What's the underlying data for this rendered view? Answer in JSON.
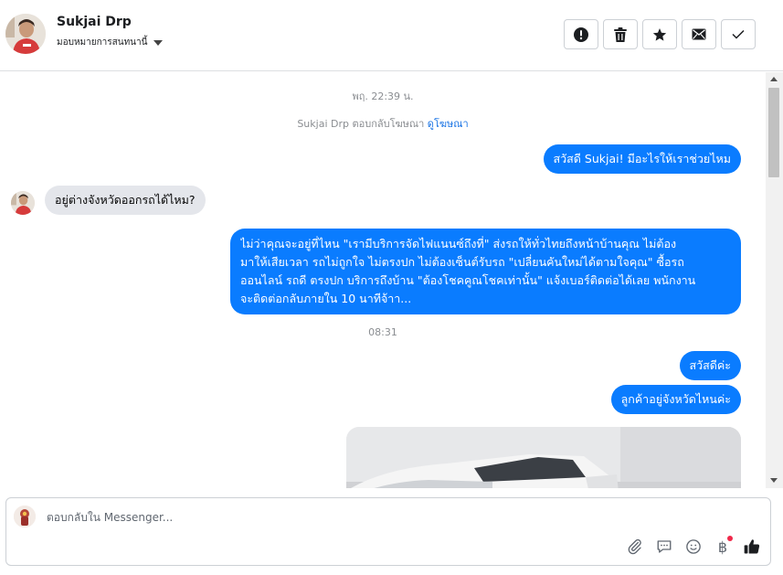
{
  "header": {
    "contact_name": "Sukjai Drp",
    "assign_label": "มอบหมายการสนทนานี้",
    "actions": [
      {
        "name": "report",
        "icon": "exclamation-circle-icon"
      },
      {
        "name": "delete",
        "icon": "trash-icon"
      },
      {
        "name": "star",
        "icon": "star-icon"
      },
      {
        "name": "mark-unread",
        "icon": "envelope-icon"
      },
      {
        "name": "mark-done",
        "icon": "check-icon"
      }
    ]
  },
  "chat": {
    "timestamp_1": "พฤ. 22:39 น.",
    "ad_notice": "Sukjai Drp ตอบกลับโฆษณา",
    "ad_link": "ดูโฆษณา",
    "msg_out_1": "สวัสดี Sukjai! มีอะไรให้เราช่วยไหม",
    "msg_in_1": "อยู่ต่างจังหวัดออกรถได้ไหม?",
    "msg_out_2_line1": "ไม่ว่าคุณจะอยู่ที่ไหน \"เรามีบริการจัดไฟแนนซ์ถึงที่\"  ส่งรถให้ทั่วไทยถึงหน้าบ้านคุณ ไม่ต้อง",
    "msg_out_2_line2": "มาให้เสียเวลา รถไม่ถูกใจ ไม่ตรงปก ไม่ต้องเซ็นต์รับรถ \"เปลี่ยนคันใหม่ได้ตามใจคุณ\" ซื้อรถ",
    "msg_out_2_line3": "ออนไลน์ รถดี ตรงปก บริการถึงบ้าน \"ต้องโชคคูณโชคเท่านั้น\" แจ้งเบอร์ติดต่อได้เลย พนักงาน",
    "msg_out_2_line4": "จะติดต่อกลับภายใน 10 นาทีจ้าา...",
    "timestamp_2": "08:31",
    "msg_out_3": "สวัสดีค่ะ",
    "msg_out_4": "ลูกค้าอยู่จังหวัดไหนค่ะ"
  },
  "composer": {
    "placeholder": "ตอบกลับใน Messenger...",
    "tools": [
      "paperclip-icon",
      "saved-reply-icon",
      "emoji-icon",
      "baht-payment-icon",
      "thumbs-up-icon"
    ]
  },
  "colors": {
    "outgoing_bubble": "#0a7cff",
    "incoming_bubble": "#e4e6eb",
    "link": "#1b74e4",
    "notification_dot": "#f02849"
  }
}
